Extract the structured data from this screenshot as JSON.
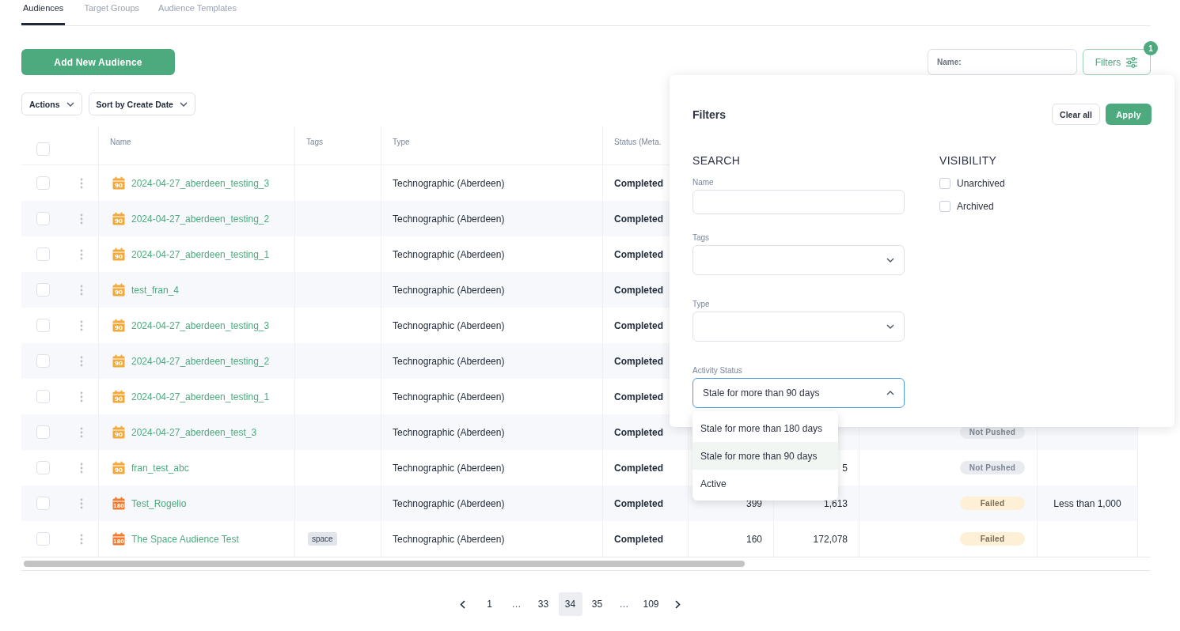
{
  "tabs": [
    {
      "label": "Audiences",
      "selected": true
    },
    {
      "label": "Target Groups",
      "selected": false
    },
    {
      "label": "Audience Templates",
      "selected": false
    }
  ],
  "add_button": "Add New Audience",
  "toolbar": {
    "actions": "Actions",
    "sort": "Sort by Create Date"
  },
  "name_search": {
    "placeholder": "Name:"
  },
  "filters_button": {
    "label": "Filters",
    "badge": "1"
  },
  "table": {
    "header_checked": false,
    "columns": [
      "Name",
      "Tags",
      "Type",
      "Status (Meta."
    ],
    "rows": [
      {
        "checked": false,
        "stale_days": "90",
        "name": "2024-04-27_aberdeen_testing_3",
        "type": "Technographic (Aberdeen)",
        "status": "Completed"
      },
      {
        "checked": false,
        "stale_days": "90",
        "name": "2024-04-27_aberdeen_testing_2",
        "type": "Technographic (Aberdeen)",
        "status": "Completed"
      },
      {
        "checked": false,
        "stale_days": "90",
        "name": "2024-04-27_aberdeen_testing_1",
        "type": "Technographic (Aberdeen)",
        "status": "Completed"
      },
      {
        "checked": false,
        "stale_days": "90",
        "name": "test_fran_4",
        "type": "Technographic (Aberdeen)",
        "status": "Completed"
      },
      {
        "checked": false,
        "stale_days": "90",
        "name": "2024-04-27_aberdeen_testing_3",
        "type": "Technographic (Aberdeen)",
        "status": "Completed"
      },
      {
        "checked": false,
        "stale_days": "90",
        "name": "2024-04-27_aberdeen_testing_2",
        "type": "Technographic (Aberdeen)",
        "status": "Completed"
      },
      {
        "checked": false,
        "stale_days": "90",
        "name": "2024-04-27_aberdeen_testing_1",
        "type": "Technographic (Aberdeen)",
        "status": "Completed"
      },
      {
        "checked": false,
        "stale_days": "90",
        "name": "2024-04-27_aberdeen_test_3",
        "type": "Technographic (Aberdeen)",
        "status": "Completed",
        "push_status": {
          "label": "Not Pushed",
          "kind": "not_pushed"
        }
      },
      {
        "checked": false,
        "stale_days": "90",
        "name": "fran_test_abc",
        "type": "Technographic (Aberdeen)",
        "status": "Completed",
        "column_7": "5",
        "push_status": {
          "label": "Not Pushed",
          "kind": "not_pushed"
        }
      },
      {
        "checked": false,
        "stale_days": "180",
        "name": "Test_Rogelio",
        "type": "Technographic (Aberdeen)",
        "status": "Completed",
        "column_6": "399",
        "column_7": "1,613",
        "push_status": {
          "label": "Failed",
          "kind": "failed"
        },
        "column_9": "Less than 1,000"
      },
      {
        "checked": false,
        "stale_days": "180",
        "name": "The Space Audience Test",
        "tags": [
          "space"
        ],
        "type": "Technographic (Aberdeen)",
        "status": "Completed",
        "column_6": "160",
        "column_7": "172,078",
        "push_status": {
          "label": "Failed",
          "kind": "failed"
        }
      }
    ]
  },
  "filters_panel": {
    "title": "Filters",
    "clear": "Clear all",
    "apply": "Apply",
    "search": {
      "heading": "SEARCH",
      "fields": [
        {
          "kind": "text",
          "label": "Name"
        },
        {
          "kind": "select",
          "label": "Tags",
          "expanded": false
        },
        {
          "kind": "select",
          "label": "Type",
          "expanded": false
        },
        {
          "kind": "select",
          "label": "Activity Status",
          "value": "Stale for more than 90 days",
          "expanded": true,
          "options": [
            {
              "label": "Stale for more than 180 days",
              "selected": false
            },
            {
              "label": "Stale for more than 90 days",
              "selected": true
            },
            {
              "label": "Active",
              "selected": false
            }
          ]
        }
      ]
    },
    "visibility": {
      "heading": "VISIBILITY",
      "options": [
        {
          "label": "Unarchived",
          "checked": false
        },
        {
          "label": "Archived",
          "checked": false
        }
      ]
    }
  },
  "pagination": {
    "pages": [
      {
        "kind": "page",
        "label": "1",
        "selected": false
      },
      {
        "kind": "gap",
        "label": "…"
      },
      {
        "kind": "page",
        "label": "33",
        "selected": false
      },
      {
        "kind": "page",
        "label": "34",
        "selected": true
      },
      {
        "kind": "page",
        "label": "35",
        "selected": false
      },
      {
        "kind": "gap",
        "label": "…"
      },
      {
        "kind": "page",
        "label": "109",
        "selected": false
      }
    ]
  }
}
